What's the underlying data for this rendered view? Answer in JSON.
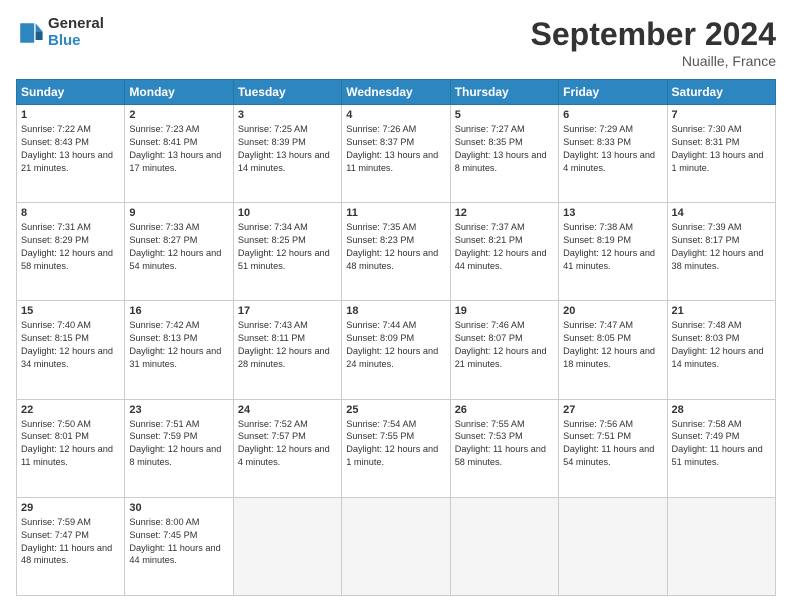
{
  "header": {
    "logo_line1": "General",
    "logo_line2": "Blue",
    "month_title": "September 2024",
    "location": "Nuaille, France"
  },
  "days_of_week": [
    "Sunday",
    "Monday",
    "Tuesday",
    "Wednesday",
    "Thursday",
    "Friday",
    "Saturday"
  ],
  "weeks": [
    [
      {
        "day": "1",
        "sunrise": "Sunrise: 7:22 AM",
        "sunset": "Sunset: 8:43 PM",
        "daylight": "Daylight: 13 hours and 21 minutes."
      },
      {
        "day": "2",
        "sunrise": "Sunrise: 7:23 AM",
        "sunset": "Sunset: 8:41 PM",
        "daylight": "Daylight: 13 hours and 17 minutes."
      },
      {
        "day": "3",
        "sunrise": "Sunrise: 7:25 AM",
        "sunset": "Sunset: 8:39 PM",
        "daylight": "Daylight: 13 hours and 14 minutes."
      },
      {
        "day": "4",
        "sunrise": "Sunrise: 7:26 AM",
        "sunset": "Sunset: 8:37 PM",
        "daylight": "Daylight: 13 hours and 11 minutes."
      },
      {
        "day": "5",
        "sunrise": "Sunrise: 7:27 AM",
        "sunset": "Sunset: 8:35 PM",
        "daylight": "Daylight: 13 hours and 8 minutes."
      },
      {
        "day": "6",
        "sunrise": "Sunrise: 7:29 AM",
        "sunset": "Sunset: 8:33 PM",
        "daylight": "Daylight: 13 hours and 4 minutes."
      },
      {
        "day": "7",
        "sunrise": "Sunrise: 7:30 AM",
        "sunset": "Sunset: 8:31 PM",
        "daylight": "Daylight: 13 hours and 1 minute."
      }
    ],
    [
      {
        "day": "8",
        "sunrise": "Sunrise: 7:31 AM",
        "sunset": "Sunset: 8:29 PM",
        "daylight": "Daylight: 12 hours and 58 minutes."
      },
      {
        "day": "9",
        "sunrise": "Sunrise: 7:33 AM",
        "sunset": "Sunset: 8:27 PM",
        "daylight": "Daylight: 12 hours and 54 minutes."
      },
      {
        "day": "10",
        "sunrise": "Sunrise: 7:34 AM",
        "sunset": "Sunset: 8:25 PM",
        "daylight": "Daylight: 12 hours and 51 minutes."
      },
      {
        "day": "11",
        "sunrise": "Sunrise: 7:35 AM",
        "sunset": "Sunset: 8:23 PM",
        "daylight": "Daylight: 12 hours and 48 minutes."
      },
      {
        "day": "12",
        "sunrise": "Sunrise: 7:37 AM",
        "sunset": "Sunset: 8:21 PM",
        "daylight": "Daylight: 12 hours and 44 minutes."
      },
      {
        "day": "13",
        "sunrise": "Sunrise: 7:38 AM",
        "sunset": "Sunset: 8:19 PM",
        "daylight": "Daylight: 12 hours and 41 minutes."
      },
      {
        "day": "14",
        "sunrise": "Sunrise: 7:39 AM",
        "sunset": "Sunset: 8:17 PM",
        "daylight": "Daylight: 12 hours and 38 minutes."
      }
    ],
    [
      {
        "day": "15",
        "sunrise": "Sunrise: 7:40 AM",
        "sunset": "Sunset: 8:15 PM",
        "daylight": "Daylight: 12 hours and 34 minutes."
      },
      {
        "day": "16",
        "sunrise": "Sunrise: 7:42 AM",
        "sunset": "Sunset: 8:13 PM",
        "daylight": "Daylight: 12 hours and 31 minutes."
      },
      {
        "day": "17",
        "sunrise": "Sunrise: 7:43 AM",
        "sunset": "Sunset: 8:11 PM",
        "daylight": "Daylight: 12 hours and 28 minutes."
      },
      {
        "day": "18",
        "sunrise": "Sunrise: 7:44 AM",
        "sunset": "Sunset: 8:09 PM",
        "daylight": "Daylight: 12 hours and 24 minutes."
      },
      {
        "day": "19",
        "sunrise": "Sunrise: 7:46 AM",
        "sunset": "Sunset: 8:07 PM",
        "daylight": "Daylight: 12 hours and 21 minutes."
      },
      {
        "day": "20",
        "sunrise": "Sunrise: 7:47 AM",
        "sunset": "Sunset: 8:05 PM",
        "daylight": "Daylight: 12 hours and 18 minutes."
      },
      {
        "day": "21",
        "sunrise": "Sunrise: 7:48 AM",
        "sunset": "Sunset: 8:03 PM",
        "daylight": "Daylight: 12 hours and 14 minutes."
      }
    ],
    [
      {
        "day": "22",
        "sunrise": "Sunrise: 7:50 AM",
        "sunset": "Sunset: 8:01 PM",
        "daylight": "Daylight: 12 hours and 11 minutes."
      },
      {
        "day": "23",
        "sunrise": "Sunrise: 7:51 AM",
        "sunset": "Sunset: 7:59 PM",
        "daylight": "Daylight: 12 hours and 8 minutes."
      },
      {
        "day": "24",
        "sunrise": "Sunrise: 7:52 AM",
        "sunset": "Sunset: 7:57 PM",
        "daylight": "Daylight: 12 hours and 4 minutes."
      },
      {
        "day": "25",
        "sunrise": "Sunrise: 7:54 AM",
        "sunset": "Sunset: 7:55 PM",
        "daylight": "Daylight: 12 hours and 1 minute."
      },
      {
        "day": "26",
        "sunrise": "Sunrise: 7:55 AM",
        "sunset": "Sunset: 7:53 PM",
        "daylight": "Daylight: 11 hours and 58 minutes."
      },
      {
        "day": "27",
        "sunrise": "Sunrise: 7:56 AM",
        "sunset": "Sunset: 7:51 PM",
        "daylight": "Daylight: 11 hours and 54 minutes."
      },
      {
        "day": "28",
        "sunrise": "Sunrise: 7:58 AM",
        "sunset": "Sunset: 7:49 PM",
        "daylight": "Daylight: 11 hours and 51 minutes."
      }
    ],
    [
      {
        "day": "29",
        "sunrise": "Sunrise: 7:59 AM",
        "sunset": "Sunset: 7:47 PM",
        "daylight": "Daylight: 11 hours and 48 minutes."
      },
      {
        "day": "30",
        "sunrise": "Sunrise: 8:00 AM",
        "sunset": "Sunset: 7:45 PM",
        "daylight": "Daylight: 11 hours and 44 minutes."
      },
      null,
      null,
      null,
      null,
      null
    ]
  ]
}
